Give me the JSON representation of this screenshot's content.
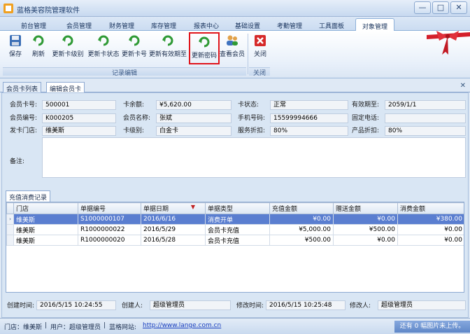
{
  "app": {
    "title": "蓝格美容院管理软件"
  },
  "window_controls": {
    "minimize": "—",
    "maximize": "□",
    "close": "✕"
  },
  "menu_tabs": [
    "前台管理",
    "会员管理",
    "财务管理",
    "库存管理",
    "报表中心",
    "基础设置",
    "考勤管理",
    "工具面板",
    "对象管理"
  ],
  "ribbon": {
    "buttons": [
      "保存",
      "刷新",
      "更新卡级别",
      "更新卡状态",
      "更新卡号",
      "更新有效期至",
      "更新密码",
      "查看会员",
      "关闭"
    ],
    "groups": [
      "记录编辑",
      "关闭"
    ],
    "highlighted": "更新密码"
  },
  "content_tabs": [
    "会员卡列表",
    "编辑会员卡"
  ],
  "close_tab_glyph": "✕",
  "form": {
    "card_no_label": "会员卡号:",
    "card_no": "500001",
    "balance_label": "卡余额:",
    "balance": "¥5,620.00",
    "card_status_label": "卡状态:",
    "card_status": "正常",
    "expiry_label": "有效期至:",
    "expiry": "2059/1/1",
    "member_no_label": "会员编号:",
    "member_no": "K000205",
    "member_name_label": "会员名称:",
    "member_name": "张斌",
    "mobile_label": "手机号码:",
    "mobile": "15599994666",
    "phone_label": "固定电话:",
    "phone": "",
    "store_label": "发卡门店:",
    "store": "维美斯",
    "level_label": "卡级别:",
    "level": "白金卡",
    "service_discount_label": "服务折扣:",
    "service_discount": "80%",
    "product_discount_label": "产品折扣:",
    "product_discount": "80%",
    "remark_label": "备注:",
    "remark": ""
  },
  "records": {
    "tab": "充值消费记录",
    "columns": [
      "门店",
      "单据编号",
      "单据日期",
      "单据类型",
      "充值金额",
      "赠送金额",
      "消费金额"
    ],
    "rows": [
      [
        "维美斯",
        "S1000000107",
        "2016/6/16",
        "消费开单",
        "¥0.00",
        "¥0.00",
        "¥380.00"
      ],
      [
        "维美斯",
        "R1000000022",
        "2016/5/29",
        "会员卡充值",
        "¥5,000.00",
        "¥500.00",
        "¥0.00"
      ],
      [
        "维美斯",
        "R1000000020",
        "2016/5/28",
        "会员卡充值",
        "¥500.00",
        "¥0.00",
        "¥0.00"
      ]
    ],
    "selected_row": 0,
    "row_indicator": "›",
    "sort_glyph": "▼"
  },
  "audit": {
    "created_time_label": "创建时间:",
    "created_time": "2016/5/15 10:24:55",
    "creator_label": "创建人:",
    "creator": "超级管理员",
    "modified_time_label": "修改时间:",
    "modified_time": "2016/5/15 10:25:48",
    "modifier_label": "修改人:",
    "modifier": "超级管理员"
  },
  "status": {
    "store": "门店：维美斯",
    "user": "用户：超级管理员",
    "site_label": "蓝格网站:",
    "site_url": "http://www.lange.com.cn",
    "separator": "|",
    "image_info": "还有 0 幅图片未上传。"
  },
  "colors": {
    "accent": "#2f5fae",
    "highlight_border": "#e0141b",
    "selected_row": "#5a7ed0"
  }
}
